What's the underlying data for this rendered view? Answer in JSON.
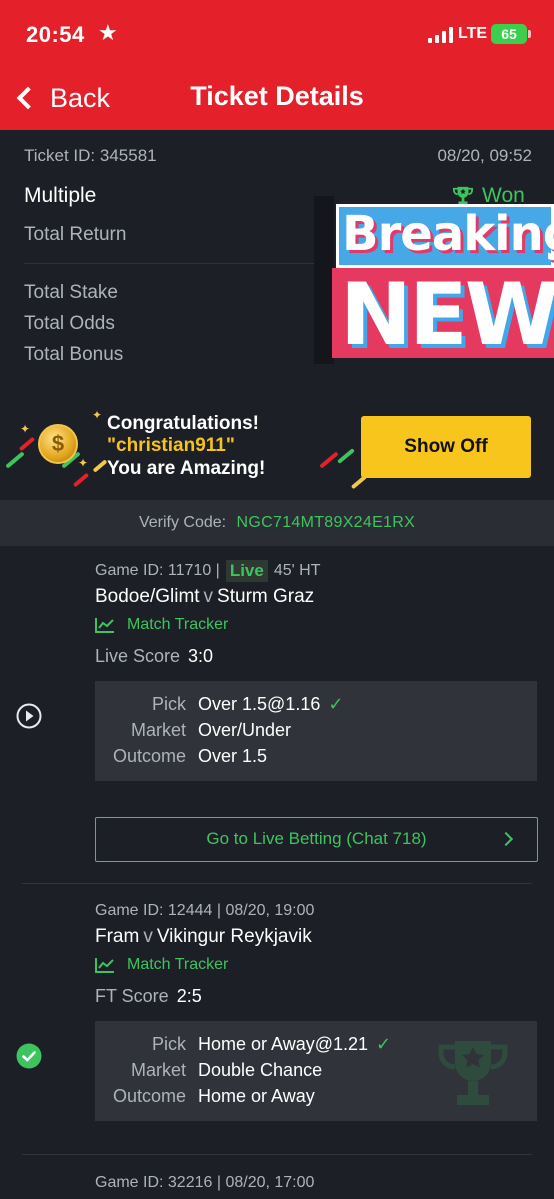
{
  "status_bar": {
    "time": "20:54",
    "network": "LTE",
    "battery": "65"
  },
  "nav": {
    "back_label": "Back",
    "title": "Ticket Details"
  },
  "ticket": {
    "id_label": "Ticket ID: 345581",
    "datetime": "08/20, 09:52",
    "type": "Multiple",
    "status": "Won",
    "rows": [
      "Total Return",
      "Total Stake",
      "Total Odds",
      "Total Bonus"
    ]
  },
  "promo_overlay": {
    "line1": "Breaking",
    "line2": "NEW"
  },
  "congrats": {
    "line1": "Congratulations!",
    "username": "\"christian911\"",
    "line3": "You are Amazing!",
    "button": "Show Off",
    "coin_symbol": "$"
  },
  "verify": {
    "label": "Verify Code:",
    "code": "NGC714MT89X24E1RX"
  },
  "games": [
    {
      "id_label": "Game ID: 11710 |",
      "live_badge": "Live",
      "time_info": "45' HT",
      "home": "Bodoe/Glimt",
      "vs": "v",
      "away": "Sturm Graz",
      "tracker": "Match Tracker",
      "score_label": "Live Score",
      "score": "3:0",
      "pick_label": "Pick",
      "pick": "Over 1.5@1.16",
      "market_label": "Market",
      "market": "Over/Under",
      "outcome_label": "Outcome",
      "outcome": "Over 1.5",
      "live_button": "Go to Live Betting (Chat 718)"
    },
    {
      "id_label": "Game ID: 12444 | 08/20, 19:00",
      "home": "Fram",
      "vs": "v",
      "away": "Vikingur Reykjavik",
      "tracker": "Match Tracker",
      "score_label": "FT Score",
      "score": "2:5",
      "pick_label": "Pick",
      "pick": "Home or Away@1.21",
      "market_label": "Market",
      "market": "Double Chance",
      "outcome_label": "Outcome",
      "outcome": "Home or Away"
    },
    {
      "id_label": "Game ID: 32216 | 08/20, 17:00"
    }
  ],
  "colors": {
    "brand_red": "#e4202a",
    "win_green": "#3ec45e",
    "cta_yellow": "#f7c51b",
    "background": "#1c1f26"
  },
  "icons": [
    "star-icon",
    "signal-icon",
    "battery-icon",
    "back-chevron-icon",
    "trophy-icon",
    "coin-icon",
    "chart-icon",
    "play-icon",
    "check-icon",
    "chevron-right-icon"
  ]
}
